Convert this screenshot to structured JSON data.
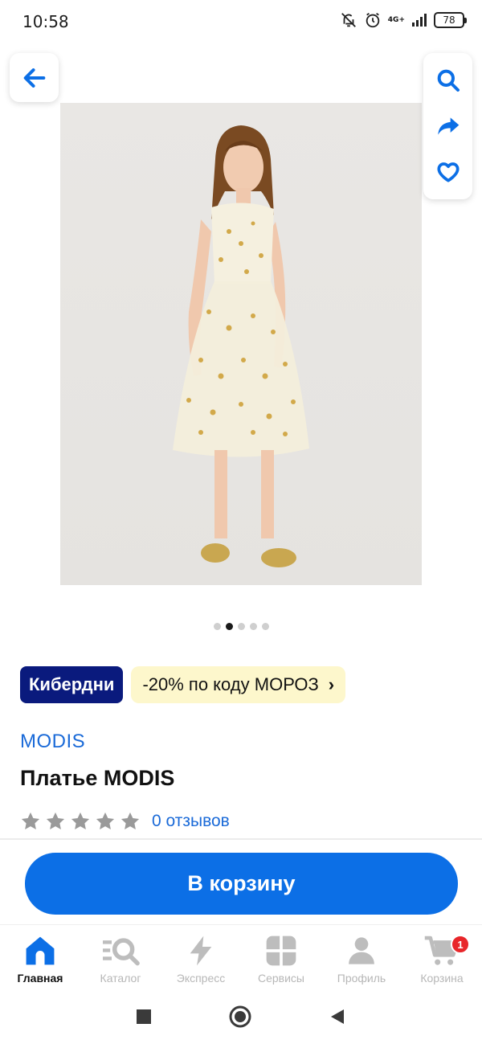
{
  "status_bar": {
    "time": "10:58",
    "network": "4G+",
    "battery": "78"
  },
  "colors": {
    "accent": "#0c6fe6",
    "brand_link": "#1a6ad8",
    "kiberdni_bg": "#0a1a7d",
    "promo_bg": "#fdf7cc",
    "badge_red": "#e8262a"
  },
  "header": {
    "back_icon": "arrow-left-icon",
    "actions": [
      "search-icon",
      "share-icon",
      "heart-icon"
    ]
  },
  "gallery": {
    "total_images": 5,
    "active_index": 1
  },
  "promo": {
    "badge": "Кибердни",
    "code_text": "-20% по коду МОРОЗ",
    "chevron": "›"
  },
  "product": {
    "brand": "MODIS",
    "title": "Платье MODIS",
    "rating": 0,
    "reviews": "0 отзывов"
  },
  "cart_button": {
    "label": "В корзину"
  },
  "bottom_nav": {
    "items": [
      {
        "label": "Главная",
        "icon": "home-icon"
      },
      {
        "label": "Каталог",
        "icon": "catalog-search-icon"
      },
      {
        "label": "Экспресс",
        "icon": "lightning-icon"
      },
      {
        "label": "Сервисы",
        "icon": "services-grid-icon"
      },
      {
        "label": "Профиль",
        "icon": "profile-icon"
      },
      {
        "label": "Корзина",
        "icon": "cart-icon"
      }
    ],
    "cart_count": "1"
  },
  "system_nav": [
    "recents-square-icon",
    "home-circle-icon",
    "back-triangle-icon"
  ]
}
